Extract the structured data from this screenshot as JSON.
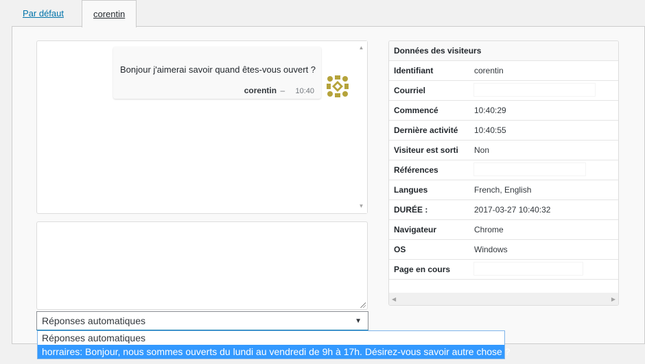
{
  "tabs": [
    {
      "label": "Par défaut"
    },
    {
      "label": "corentin"
    }
  ],
  "chat": {
    "message_text": "Bonjour j'aimerai savoir quand êtes-vous ouvert ?",
    "author": "corentin",
    "dash": "–",
    "time": "10:40",
    "avatar_color": "#b5a33b"
  },
  "reply": {
    "value": ""
  },
  "auto_responses": {
    "selected": "Réponses automatiques",
    "options": [
      "Réponses automatiques",
      "horraires: Bonjour, nous sommes ouverts du lundi au vendredi de 9h à 17h. Désirez-vous savoir autre chose ?"
    ]
  },
  "visitor": {
    "title": "Données des visiteurs",
    "rows": [
      {
        "label": "Identifiant",
        "value": "corentin"
      },
      {
        "label": "Courriel",
        "value": ""
      },
      {
        "label": "Commencé",
        "value": "10:40:29"
      },
      {
        "label": "Dernière activité",
        "value": "10:40:55"
      },
      {
        "label": "Visiteur est sorti",
        "value": "Non"
      },
      {
        "label": "Références",
        "value": ""
      },
      {
        "label": "Langues",
        "value": "French, English"
      },
      {
        "label": "DURÉE :",
        "value": "2017-03-27 10:40:32"
      },
      {
        "label": "Navigateur",
        "value": "Chrome"
      },
      {
        "label": "OS",
        "value": "Windows"
      },
      {
        "label": "Page en cours",
        "value": ""
      }
    ]
  },
  "colors": {
    "link": "#0073aa",
    "highlight": "#3399ff"
  }
}
